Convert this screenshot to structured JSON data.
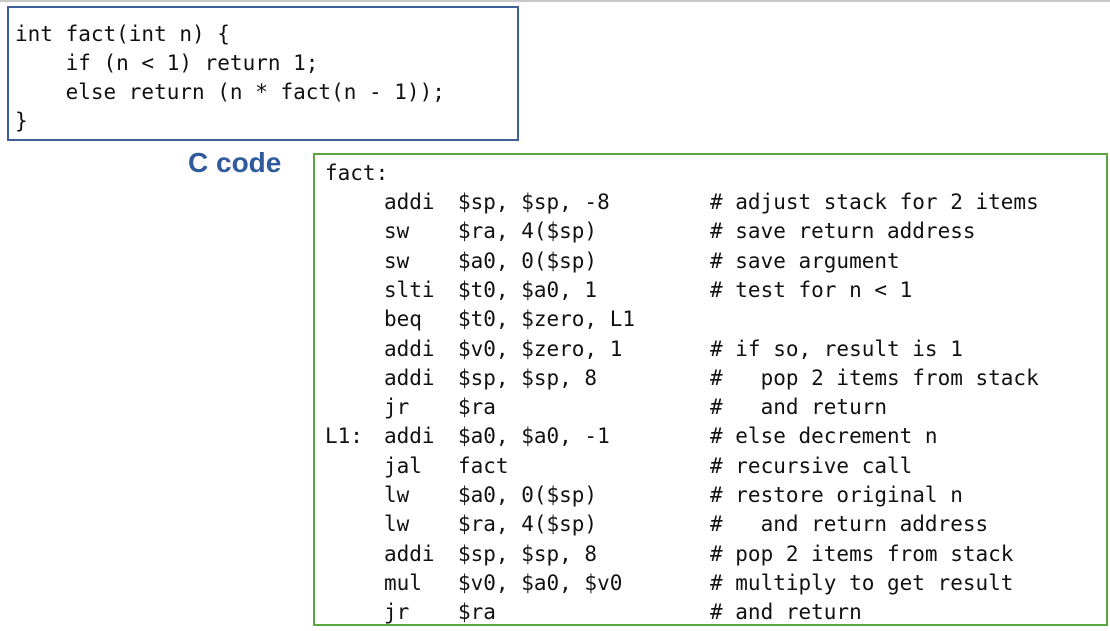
{
  "c_code": {
    "label": "C code",
    "lines": [
      "int fact(int n) {",
      "    if (n < 1) return 1;",
      "    else return (n * fact(n - 1));",
      "}"
    ]
  },
  "mips_code": {
    "header": "fact:",
    "rows": [
      {
        "label": "",
        "op": "addi",
        "args": "$sp, $sp, -8",
        "comment": "# adjust stack for 2 items"
      },
      {
        "label": "",
        "op": "sw",
        "args": "$ra, 4($sp)",
        "comment": "# save return address"
      },
      {
        "label": "",
        "op": "sw",
        "args": "$a0, 0($sp)",
        "comment": "# save argument"
      },
      {
        "label": "",
        "op": "slti",
        "args": "$t0, $a0, 1",
        "comment": "# test for n < 1"
      },
      {
        "label": "",
        "op": "beq",
        "args": "$t0, $zero, L1",
        "comment": ""
      },
      {
        "label": "",
        "op": "addi",
        "args": "$v0, $zero, 1",
        "comment": "# if so, result is 1"
      },
      {
        "label": "",
        "op": "addi",
        "args": "$sp, $sp, 8",
        "comment": "#   pop 2 items from stack"
      },
      {
        "label": "",
        "op": "jr",
        "args": "$ra",
        "comment": "#   and return"
      },
      {
        "label": "L1:",
        "op": "addi",
        "args": "$a0, $a0, -1",
        "comment": "# else decrement n"
      },
      {
        "label": "",
        "op": "jal",
        "args": "fact",
        "comment": "# recursive call"
      },
      {
        "label": "",
        "op": "lw",
        "args": "$a0, 0($sp)",
        "comment": "# restore original n"
      },
      {
        "label": "",
        "op": "lw",
        "args": "$ra, 4($sp)",
        "comment": "#   and return address"
      },
      {
        "label": "",
        "op": "addi",
        "args": "$sp, $sp, 8",
        "comment": "# pop 2 items from stack"
      },
      {
        "label": "",
        "op": "mul",
        "args": "$v0, $a0, $v0",
        "comment": "# multiply to get result"
      },
      {
        "label": "",
        "op": "jr",
        "args": "$ra",
        "comment": "# and return"
      }
    ]
  },
  "colors": {
    "c_box_border": "#3d5f96",
    "asm_box_border": "#5aa640",
    "label_color": "#2f5a9c"
  }
}
